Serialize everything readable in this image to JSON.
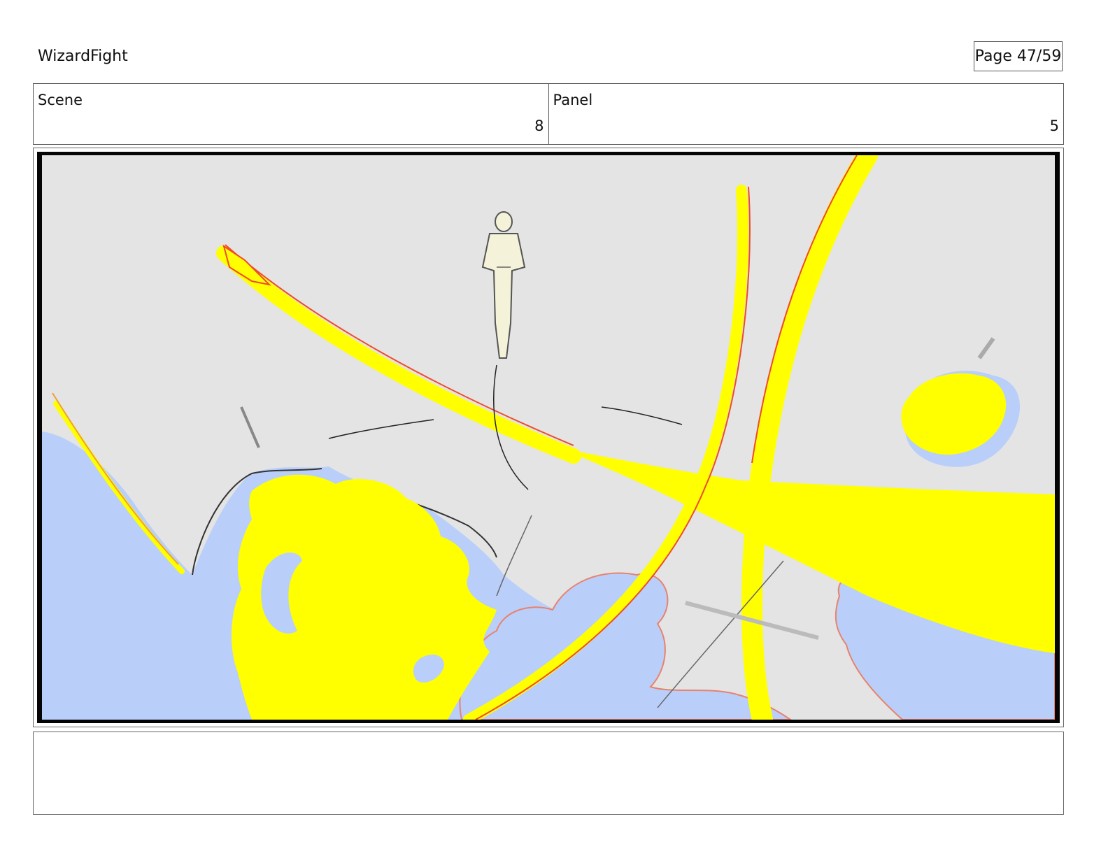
{
  "header": {
    "project_title": "WizardFight",
    "page_label": "Page 47/59"
  },
  "info": {
    "scene_label": "Scene",
    "scene_value": "8",
    "panel_label": "Panel",
    "panel_value": "5"
  },
  "panel": {
    "colors": {
      "background": "#e4e4e4",
      "smoke": "#b9cff9",
      "fire": "#ffff00",
      "fire_edge": "#f04a2a",
      "line": "#222222"
    }
  },
  "notes": {
    "text": ""
  }
}
